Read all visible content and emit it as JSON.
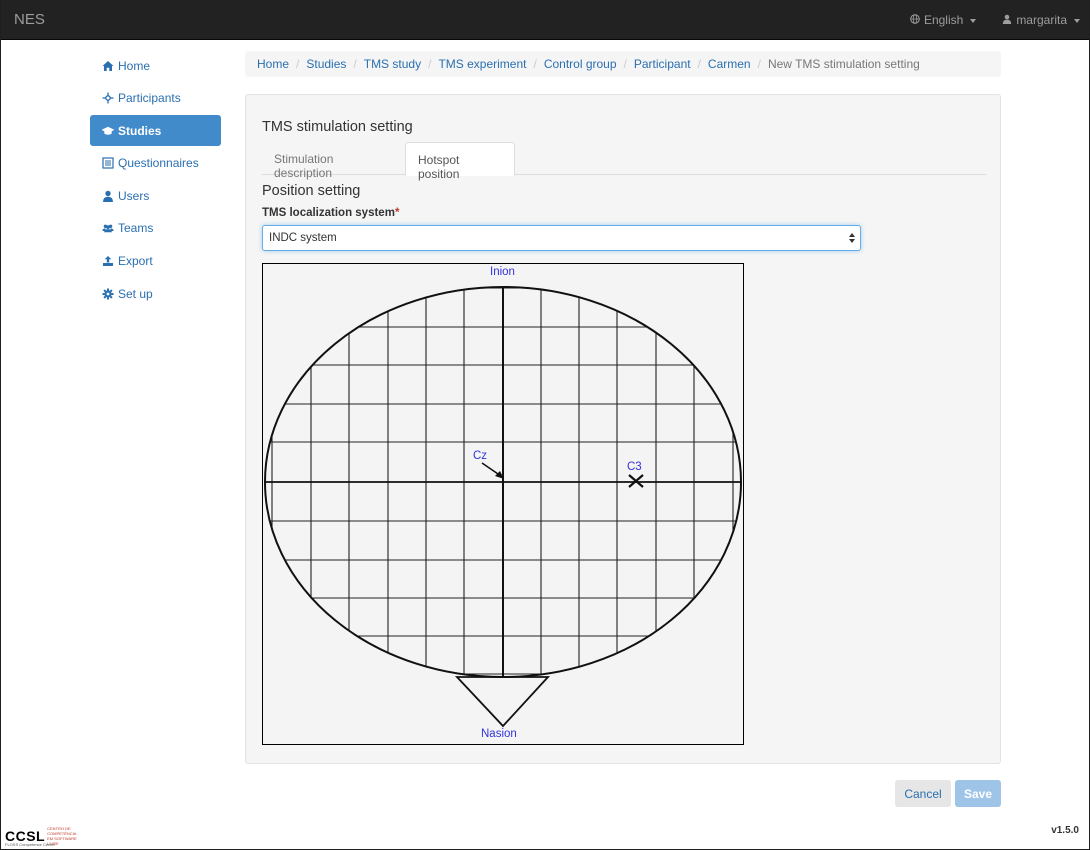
{
  "navbar": {
    "brand": "NES",
    "language": "English",
    "user": "margarita"
  },
  "sidebar": {
    "items": [
      {
        "label": "Home",
        "icon": "home-icon",
        "active": false
      },
      {
        "label": "Participants",
        "icon": "participants-icon",
        "active": false
      },
      {
        "label": "Studies",
        "icon": "graduation-cap-icon",
        "active": true
      },
      {
        "label": "Questionnaires",
        "icon": "list-icon",
        "active": false
      },
      {
        "label": "Users",
        "icon": "user-icon",
        "active": false
      },
      {
        "label": "Teams",
        "icon": "team-icon",
        "active": false
      },
      {
        "label": "Export",
        "icon": "export-icon",
        "active": false
      },
      {
        "label": "Set up",
        "icon": "gear-icon",
        "active": false
      }
    ]
  },
  "breadcrumb": {
    "items": [
      "Home",
      "Studies",
      "TMS study",
      "TMS experiment",
      "Control group",
      "Participant",
      "Carmen"
    ],
    "current": "New TMS stimulation setting"
  },
  "panel": {
    "title": "TMS stimulation setting",
    "tabs": [
      {
        "label": "Stimulation description",
        "active": false
      },
      {
        "label": "Hotspot position",
        "active": true
      }
    ],
    "section_title": "Position setting",
    "field_label": "TMS localization system",
    "required_mark": "*",
    "select_value": "INDC system",
    "map": {
      "top_label": "Inion",
      "bottom_label": "Nasion",
      "center_label": "Cz",
      "marker_label": "C3"
    }
  },
  "footer": {
    "cancel_label": "Cancel",
    "save_label": "Save",
    "logo_text": "CCSL",
    "logo_subtext": "CENTRO DE COMPETÊNCIA EM SOFTWARE LIVRE",
    "logo_caption": "FLOSS Competence Center",
    "version": "v1.5.0"
  },
  "colors": {
    "navbar_bg": "#222222",
    "active_item_bg": "#428bca",
    "link": "#2a6fb0",
    "save_button": "#9ec4e8",
    "map_label": "#3333dd"
  }
}
